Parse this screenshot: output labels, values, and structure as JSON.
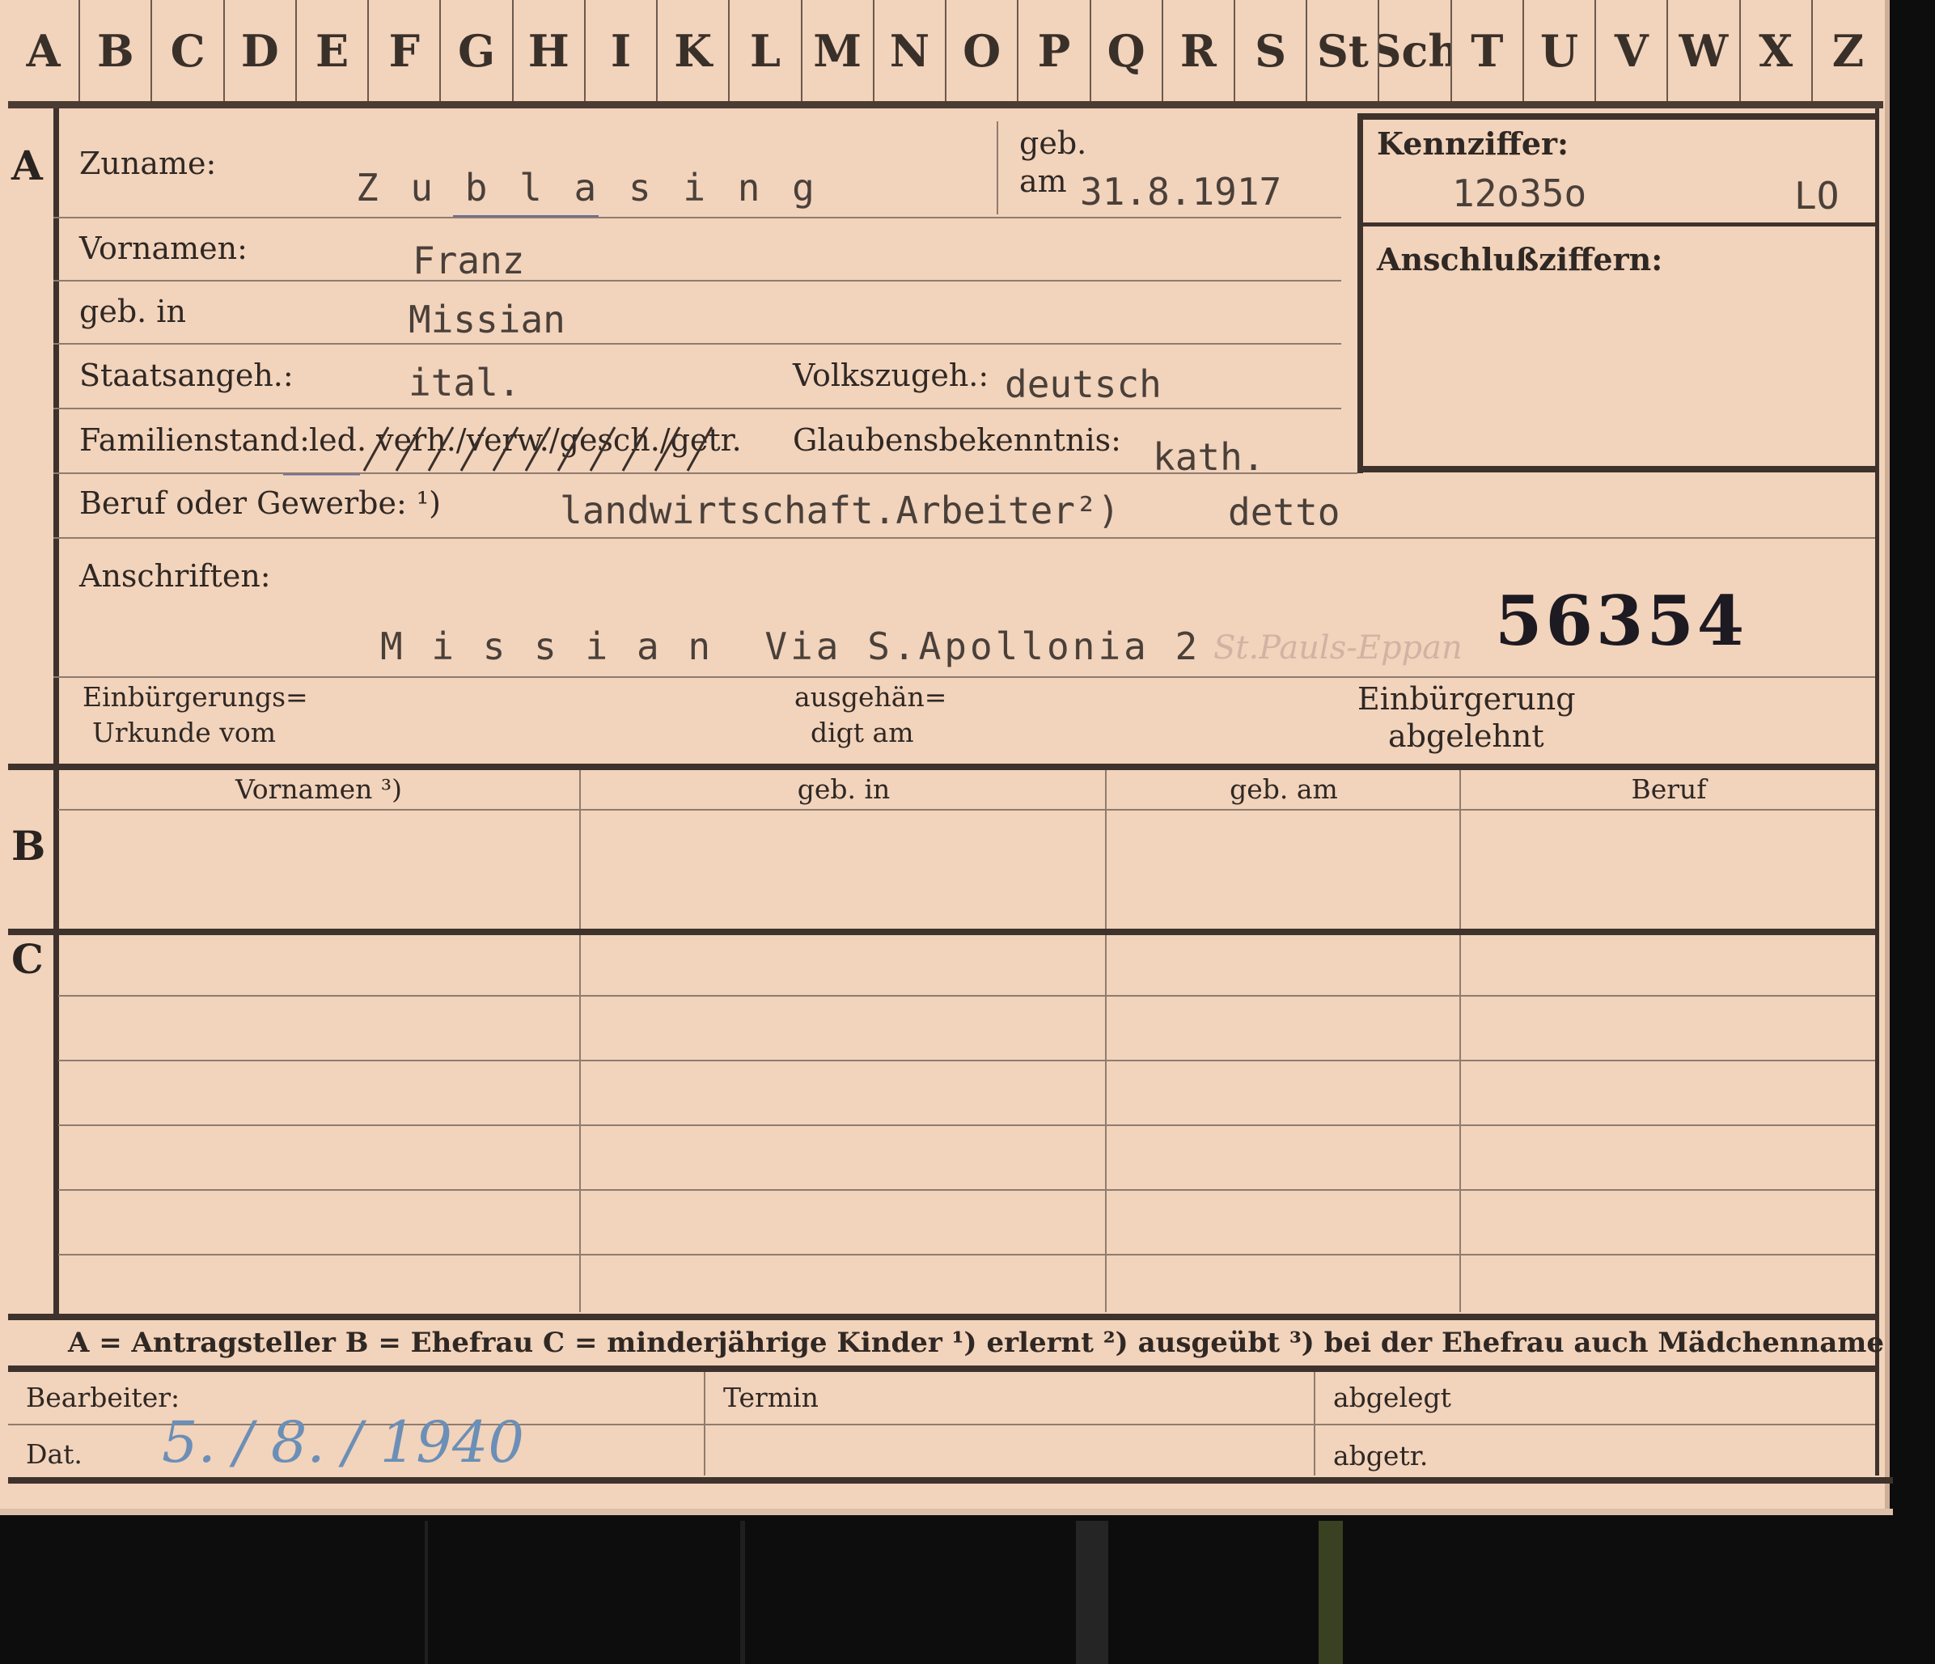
{
  "tabs": [
    "A",
    "B",
    "C",
    "D",
    "E",
    "F",
    "G",
    "H",
    "I",
    "K",
    "L",
    "M",
    "N",
    "O",
    "P",
    "Q",
    "R",
    "S",
    "St",
    "Sch",
    "T",
    "U",
    "V",
    "W",
    "X",
    "Z"
  ],
  "section_a": {
    "letter": "A",
    "zuname_label": "Zuname:",
    "zuname_value": "Z u b l a s i n g",
    "geb_label": "geb.",
    "am_label": "am",
    "birth_date": "31.8.1917",
    "kennziffer_label": "Kennziffer:",
    "kennziffer_value": "12o35o",
    "kennziffer_code": "LO",
    "anschluss_label": "Anschlußziffern:",
    "vornamen_label": "Vornamen:",
    "vornamen_value": "Franz",
    "geb_in_label": "geb. in",
    "geb_in_value": "Missian",
    "staat_label": "Staatsangeh.:",
    "staat_value": "ital.",
    "volks_label": "Volkszugeh.:",
    "volks_value": "deutsch",
    "familien_label": "Familienstand:",
    "familien_options": "led. verh./verw./gesch./getr.",
    "glaubens_label": "Glaubensbekenntnis:",
    "glaubens_value": "kath.",
    "beruf_label": "Beruf oder Gewerbe: ¹)",
    "beruf_value": "landwirtschaft.Arbeiter²)",
    "beruf_value2": "detto",
    "anschriften_label": "Anschriften:",
    "anschrift_value": "M i s s i a n  Via S.Apollonia 2",
    "anschrift_hand": "St.Pauls-Eppan",
    "big_number": "56354",
    "einb_urkunde_label_1": "Einbürgerungs=",
    "einb_urkunde_label_2": "Urkunde vom",
    "ausgehaen_label_1": "ausgehän=",
    "ausgehaen_label_2": "digt am",
    "einb_abgelehnt_1": "Einbürgerung",
    "einb_abgelehnt_2": "abgelehnt"
  },
  "section_b": {
    "letter": "B",
    "columns": [
      "Vornamen ³)",
      "geb. in",
      "geb. am",
      "Beruf"
    ]
  },
  "section_c": {
    "letter": "C"
  },
  "legend": "A = Antragsteller   B = Ehefrau   C = minderjährige Kinder   ¹) erlernt   ²) ausgeübt   ³) bei der Ehefrau auch Mädchenname",
  "footer": {
    "bearbeiter_label": "Bearbeiter:",
    "dat_label": "Dat.",
    "dat_value": "5. / 8. / 1940",
    "termin_label": "Termin",
    "abgelegt_label": "abgelegt",
    "abgetr_label": "abgetr."
  },
  "colors": {
    "card": "#f2d3bb",
    "ink": "#2a2420",
    "hand_ink": "#6b8fb6"
  }
}
